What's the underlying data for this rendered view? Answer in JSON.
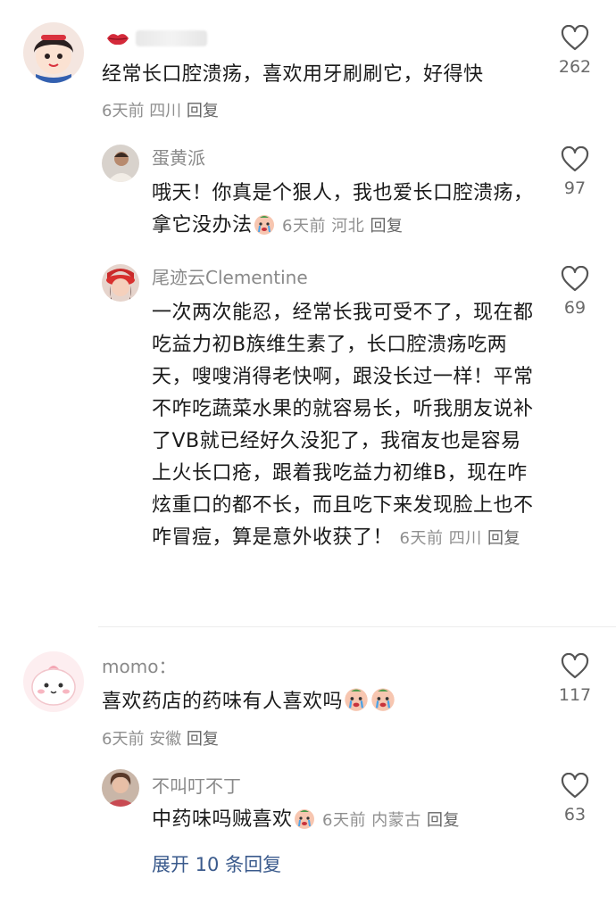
{
  "comments": [
    {
      "user": "",
      "text": "经常长口腔溃疡，喜欢用牙刷刷它，好得快",
      "time": "6天前",
      "location": "四川",
      "reply": "回复",
      "likes": "262"
    }
  ],
  "replies1": [
    {
      "user": "蛋黄派",
      "text": "哦天！你真是个狠人，我也爱长口腔溃疡，拿它没办法",
      "time": "6天前",
      "location": "河北",
      "reply": "回复",
      "likes": "97"
    },
    {
      "user": "尾迹云Clementine",
      "text": "一次两次能忍，经常长我可受不了，现在都吃益力初B族维生素了，长口腔溃疡吃两天，嗖嗖消得老快啊，跟没长过一样！平常不咋吃蔬菜水果的就容易长，听我朋友说补了VB就已经好久没犯了，我宿友也是容易上火长口疮，跟着我吃益力初维B，现在咋炫重口的都不长，而且吃下来发现脸上也不咋冒痘，算是意外收获了！",
      "time": "6天前",
      "location": "四川",
      "reply": "回复",
      "likes": "69"
    }
  ],
  "comment2": {
    "user": "momo：",
    "text": "喜欢药店的药味有人喜欢吗",
    "time": "6天前",
    "location": "安徽",
    "reply": "回复",
    "likes": "117"
  },
  "reply2": {
    "user": "不叫叮不丁",
    "text": "中药味吗贼喜欢",
    "time": "6天前",
    "location": "内蒙古",
    "reply": "回复",
    "likes": "63"
  },
  "expand": "展开 10 条回复",
  "icons": {
    "heart": "heart-outline-icon",
    "lips": "lips-icon"
  },
  "colors": {
    "username": "#8a8a8a",
    "meta": "#8f8f8f",
    "link": "#3a5a8c"
  }
}
